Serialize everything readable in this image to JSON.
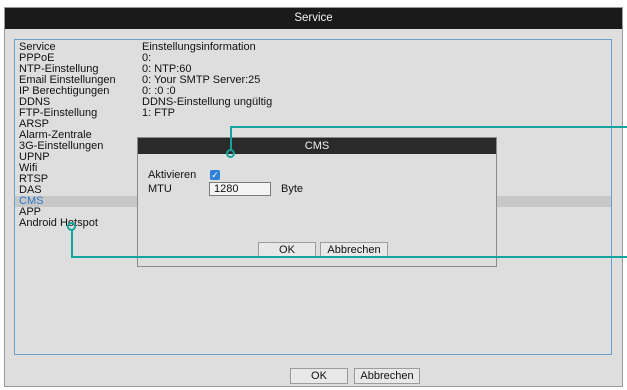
{
  "window": {
    "title": "Service"
  },
  "table": {
    "headers": [
      "Service",
      "Einstellungsinformation"
    ],
    "rows": [
      {
        "service": "PPPoE",
        "info": "0:"
      },
      {
        "service": "NTP-Einstellung",
        "info": "0: NTP:60"
      },
      {
        "service": "Email Einstellungen",
        "info": "0: Your SMTP Server:25"
      },
      {
        "service": "IP Berechtigungen",
        "info": "0: :0 :0"
      },
      {
        "service": "DDNS",
        "info": "DDNS-Einstellung ungültig"
      },
      {
        "service": "FTP-Einstellung",
        "info": "1: FTP"
      },
      {
        "service": "ARSP",
        "info": ""
      },
      {
        "service": "Alarm-Zentrale",
        "info": ""
      },
      {
        "service": "3G-Einstellungen",
        "info": ""
      },
      {
        "service": "UPNP",
        "info": ""
      },
      {
        "service": "Wifi",
        "info": ""
      },
      {
        "service": "RTSP",
        "info": ""
      },
      {
        "service": "DAS",
        "info": ""
      },
      {
        "service": "CMS",
        "info": ""
      },
      {
        "service": "APP",
        "info": ""
      },
      {
        "service": "Android Hotspot",
        "info": ""
      }
    ]
  },
  "footer": {
    "ok_label": "OK",
    "cancel_label": "Abbrechen"
  },
  "dialog": {
    "title": "CMS",
    "enable_label": "Aktivieren",
    "enable_checked": true,
    "mtu_label": "MTU",
    "mtu_value": "1280",
    "mtu_unit": "Byte",
    "ok_label": "OK",
    "cancel_label": "Abbrechen"
  },
  "colors": {
    "titlebar": "#1a1a1a",
    "panel_border": "#6aa0ce",
    "selected_text": "#2d78c8",
    "annotation": "#13a59c",
    "checkbox": "#2d82d8"
  }
}
